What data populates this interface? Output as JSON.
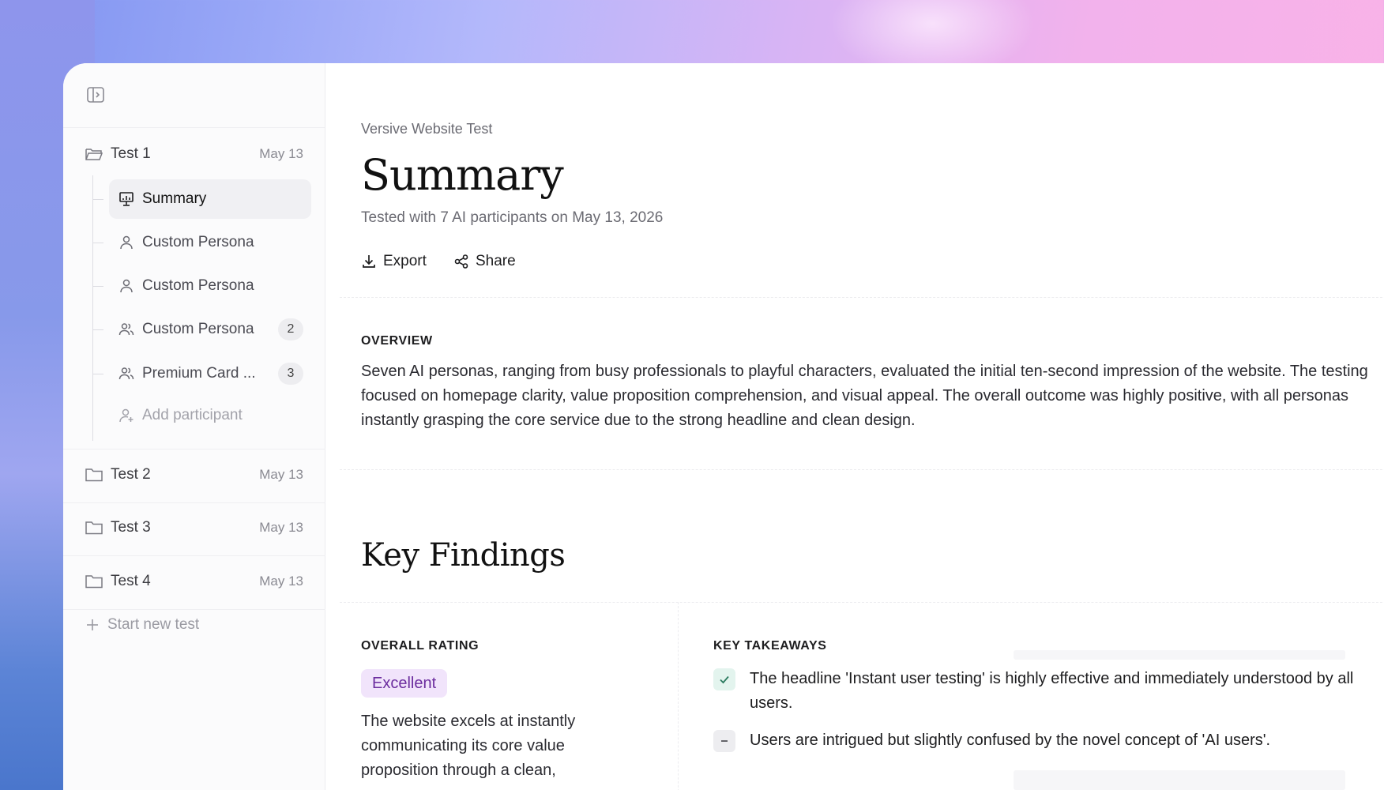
{
  "sidebar": {
    "tests": [
      {
        "name": "Test 1",
        "date": "May 13"
      },
      {
        "name": "Test 2",
        "date": "May 13"
      },
      {
        "name": "Test 3",
        "date": "May 13"
      },
      {
        "name": "Test 4",
        "date": "May 13"
      }
    ],
    "children": [
      {
        "label": "Summary",
        "icon": "presentation-icon"
      },
      {
        "label": "Custom Persona",
        "icon": "user-icon"
      },
      {
        "label": "Custom Persona",
        "icon": "user-icon"
      },
      {
        "label": "Custom Persona",
        "icon": "users-icon",
        "count": "2"
      },
      {
        "label": "Premium Card ...",
        "icon": "users-icon",
        "count": "3"
      },
      {
        "label": "Add participant",
        "icon": "user-plus-icon"
      }
    ],
    "start_new_test": "Start new test"
  },
  "header": {
    "breadcrumb": "Versive Website Test",
    "title": "Summary",
    "subtitle": "Tested with 7 AI participants on May 13, 2026",
    "export_label": "Export",
    "share_label": "Share"
  },
  "overview": {
    "label": "OVERVIEW",
    "text": "Seven AI personas, ranging from busy professionals to playful characters, evaluated the initial ten-second impression of the website. The testing focused on homepage clarity, value proposition comprehension, and visual appeal. The overall outcome was highly positive, with all personas instantly grasping the core service due to the strong headline and clean design."
  },
  "key_findings": {
    "title": "Key Findings",
    "rating_label": "OVERALL RATING",
    "rating_value": "Excellent",
    "rating_desc": "The website excels at instantly communicating its core value proposition through a clean,",
    "takeaways_label": "KEY TAKEAWAYS",
    "takeaways": [
      {
        "text": "The headline 'Instant user testing' is highly effective and immediately understood by all users.",
        "kind": "positive"
      },
      {
        "text": "Users are intrigued but slightly confused by the novel concept of 'AI users'.",
        "kind": "neutral"
      }
    ]
  },
  "colors": {
    "badge_bg": "#f1e4fb",
    "badge_text": "#6b2c9e",
    "positive_bg": "#e3f4ee",
    "positive_check": "#2a7a5e"
  }
}
